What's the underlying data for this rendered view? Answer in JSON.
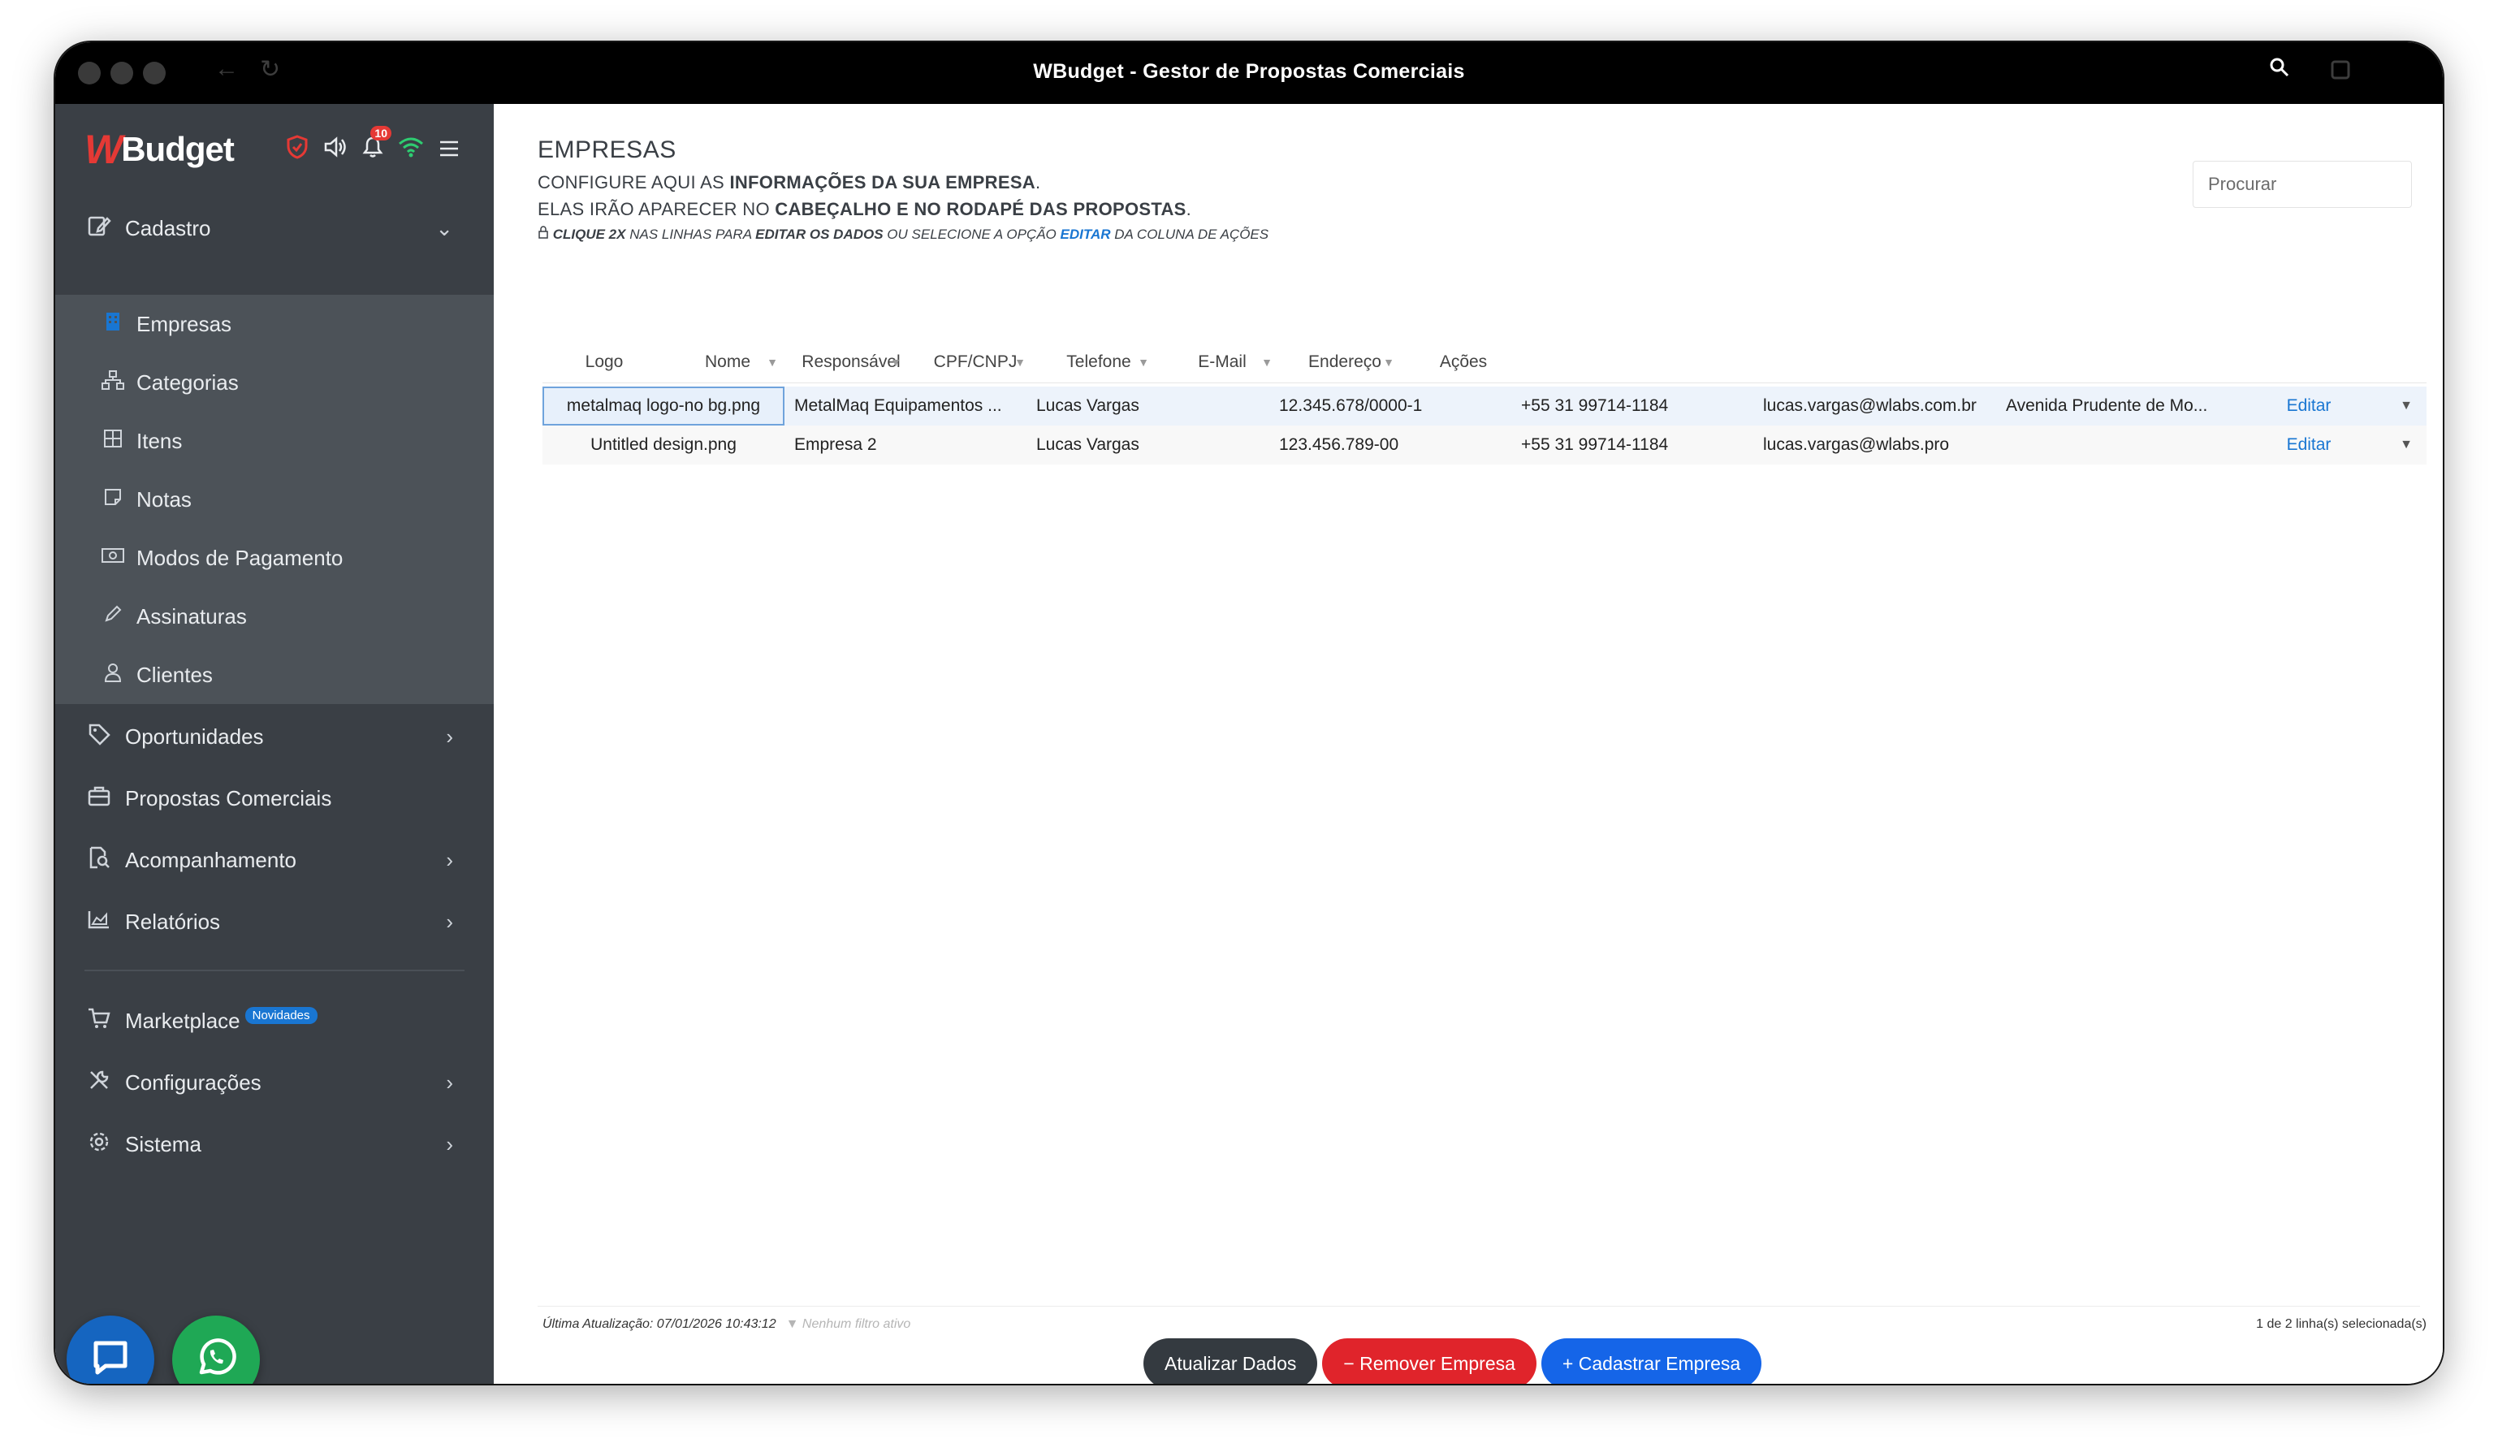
{
  "window": {
    "title": "WBudget - Gestor de Propostas Comerciais"
  },
  "sidebar": {
    "logo": {
      "mark": "W",
      "text": "Budget"
    },
    "notification_count": "10",
    "menu": {
      "cadastro": "Cadastro",
      "empresas": "Empresas",
      "categorias": "Categorias",
      "itens": "Itens",
      "notas": "Notas",
      "modos_pagamento": "Modos de Pagamento",
      "assinaturas": "Assinaturas",
      "clientes": "Clientes",
      "oportunidades": "Oportunidades",
      "propostas": "Propostas Comerciais",
      "acompanhamento": "Acompanhamento",
      "relatorios": "Relatórios",
      "marketplace": "Marketplace",
      "marketplace_badge": "Novidades",
      "configuracoes": "Configurações",
      "sistema": "Sistema"
    }
  },
  "page": {
    "title": "EMPRESAS",
    "desc1_pre": "CONFIGURE AQUI AS ",
    "desc1_bold": "INFORMAÇÕES DA SUA EMPRESA",
    "desc1_post": ".",
    "desc2_pre": "ELAS IRÃO APARECER NO ",
    "desc2_bold": "CABEÇALHO E NO RODAPÉ DAS PROPOSTAS",
    "desc2_post": ".",
    "hint_b1": "CLIQUE 2X",
    "hint_t1": " NAS LINHAS PARA ",
    "hint_b2": "EDITAR OS DADOS",
    "hint_t2": " OU SELECIONE A OPÇÃO ",
    "hint_link": "EDITAR",
    "hint_t3": " DA COLUNA DE AÇÕES",
    "search_placeholder": "Procurar"
  },
  "table": {
    "columns": [
      "Logo",
      "Nome",
      "Responsável",
      "CPF/CNPJ",
      "Telefone",
      "E-Mail",
      "Endereço",
      "Ações"
    ],
    "rows": [
      {
        "logo": "metalmaq logo-no bg.png",
        "nome": "MetalMaq Equipamentos ...",
        "responsavel": "Lucas Vargas",
        "cpf_cnpj": "12.345.678/0000-1",
        "telefone": "+55 31 99714-1184",
        "email": "lucas.vargas@wlabs.com.br",
        "endereco": "Avenida Prudente de Mo...",
        "acao": "Editar"
      },
      {
        "logo": "Untitled design.png",
        "nome": "Empresa 2",
        "responsavel": "Lucas Vargas",
        "cpf_cnpj": "123.456.789-00",
        "telefone": "+55 31 99714-1184",
        "email": "lucas.vargas@wlabs.pro",
        "endereco": "",
        "acao": "Editar"
      }
    ]
  },
  "footer": {
    "last_update": "Última Atualização: 07/01/2026 10:43:12",
    "filter_status": "Nenhum filtro ativo",
    "selection": "1 de 2 linha(s) selecionada(s)"
  },
  "actions": {
    "refresh": "Atualizar Dados",
    "remove": "− Remover Empresa",
    "add": "+ Cadastrar Empresa"
  },
  "colors": {
    "sidebar_bg": "#3a3f45",
    "accent_blue": "#1976d2",
    "danger_red": "#e0242b",
    "whatsapp_green": "#1fa855"
  }
}
